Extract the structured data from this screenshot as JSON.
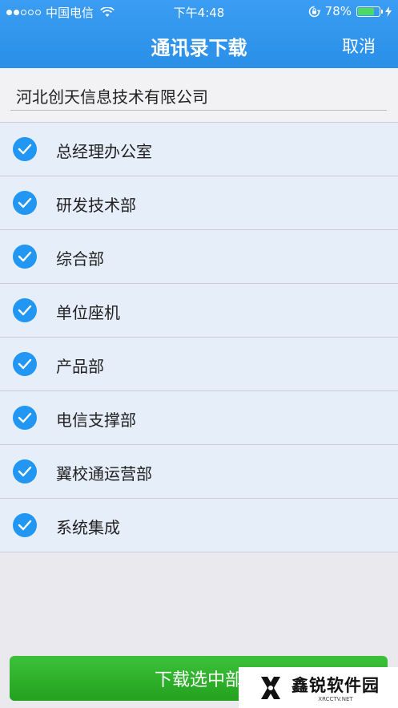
{
  "status_bar": {
    "carrier": "中国电信",
    "time": "下午4:48",
    "battery_percent_text": "78%",
    "battery_level": 0.78,
    "signal_bars_filled": 2,
    "signal_bars_total": 5
  },
  "nav": {
    "title": "通讯录下载",
    "cancel_label": "取消"
  },
  "company": {
    "name": "河北创天信息技术有限公司"
  },
  "departments": [
    {
      "label": "总经理办公室",
      "checked": true
    },
    {
      "label": "研发技术部",
      "checked": true
    },
    {
      "label": "综合部",
      "checked": true
    },
    {
      "label": "单位座机",
      "checked": true
    },
    {
      "label": "产品部",
      "checked": true
    },
    {
      "label": "电信支撑部",
      "checked": true
    },
    {
      "label": "翼校通运营部",
      "checked": true
    },
    {
      "label": "系统集成",
      "checked": true
    }
  ],
  "bottom_button": {
    "label": "下载选中部"
  },
  "watermark": {
    "main": "鑫锐软件园",
    "sub": "XRCCTV.NET"
  },
  "colors": {
    "nav_blue": "#2a8fe8",
    "check_blue": "#2196f3",
    "button_green": "#23a11f",
    "battery_green": "#4cd964"
  }
}
